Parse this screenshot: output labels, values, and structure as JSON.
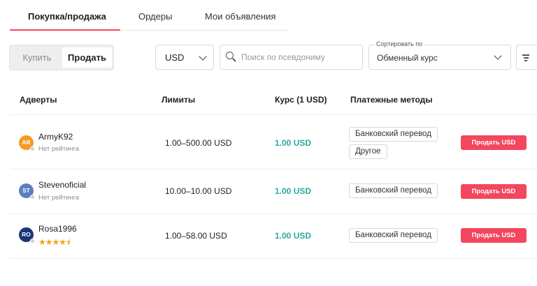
{
  "tabs": [
    "Покупка/продажа",
    "Ордеры",
    "Мои объявления"
  ],
  "toggle": {
    "buy_label": "Купить",
    "sell_label": "Продать",
    "active": "sell"
  },
  "currency": {
    "value": "USD"
  },
  "search": {
    "placeholder": "Поиск по псевдониму"
  },
  "sort": {
    "label": "Сортировать по",
    "value": "Обменный курс"
  },
  "columns": [
    "Адверты",
    "Лимиты",
    "Курс (1 USD)",
    "Платежные методы"
  ],
  "rows": [
    {
      "initials": "AR",
      "avatar_color": "#f59a23",
      "name": "ArmyK92",
      "rating": "Нет рейтинга",
      "limits": "1.00–500.00 USD",
      "rate": "1.00 USD",
      "methods": [
        "Банковский перевод",
        "Другое"
      ],
      "action": "Продать USD"
    },
    {
      "initials": "ST",
      "avatar_color": "#5a7fc0",
      "name": "Stevenoficial",
      "rating": "Нет рейтинга",
      "limits": "10.00–10.00 USD",
      "rate": "1.00 USD",
      "methods": [
        "Банковский перевод"
      ],
      "action": "Продать USD"
    },
    {
      "initials": "RO",
      "avatar_color": "#1c3478",
      "name": "Rosa1996",
      "stars": "★★★★⯨",
      "limits": "1.00–58.00 USD",
      "rate": "1.00 USD",
      "methods": [
        "Банковский перевод"
      ],
      "action": "Продать USD"
    }
  ],
  "colors": {
    "accent": "#f1495a",
    "rate": "#2aa9a1",
    "star": "#f2a31b"
  }
}
